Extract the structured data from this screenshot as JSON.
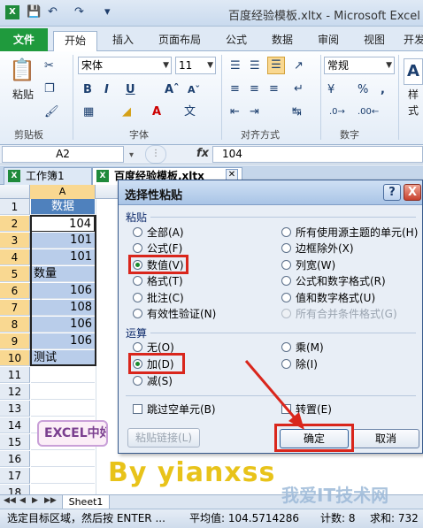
{
  "window": {
    "title": "百度经验模板.xltx - Microsoft Excel"
  },
  "quick_access": {
    "save_icon": "save-icon",
    "undo_icon": "undo-icon",
    "redo_icon": "redo-icon"
  },
  "ribbon_tabs": [
    {
      "label": "文件"
    },
    {
      "label": "开始"
    },
    {
      "label": "插入"
    },
    {
      "label": "页面布局"
    },
    {
      "label": "公式"
    },
    {
      "label": "数据"
    },
    {
      "label": "审阅"
    },
    {
      "label": "视图"
    },
    {
      "label": "开发"
    }
  ],
  "ribbon": {
    "clipboard": {
      "paste_label": "粘贴",
      "group_label": "剪贴板"
    },
    "font": {
      "font_name": "宋体",
      "font_size": "11",
      "bold": "B",
      "italic": "I",
      "underline": "U",
      "group_label": "字体"
    },
    "alignment": {
      "group_label": "对齐方式"
    },
    "number": {
      "format": "常规",
      "percent": "%",
      "comma": ",",
      "group_label": "数字"
    },
    "styles": {
      "label": "样式"
    }
  },
  "formula_bar": {
    "name_box": "A2",
    "fx": "fx",
    "value": "104"
  },
  "workbooks": [
    {
      "label": "工作簿1"
    },
    {
      "label": "百度经验模板.xltx"
    }
  ],
  "sheet": {
    "column_header": "A",
    "rows": [
      "1",
      "2",
      "3",
      "4",
      "5",
      "6",
      "7",
      "8",
      "9",
      "10",
      "11",
      "12",
      "13",
      "14",
      "15",
      "16",
      "17",
      "18"
    ],
    "cells": [
      "数据",
      "104",
      "101",
      "101",
      "数量",
      "106",
      "108",
      "106",
      "106",
      "测试"
    ]
  },
  "overlay_texts": {
    "excel_banner": "EXCEL中好",
    "byline": "By  yianxss",
    "site_watermark": "我爱IT技术网"
  },
  "sheet_tab": {
    "label": "Sheet1"
  },
  "status_bar": {
    "message": "选定目标区域，然后按 ENTER ...",
    "average": "平均值: 104.5714286",
    "count": "计数: 8",
    "sum": "求和: 732"
  },
  "dialog": {
    "title": "选择性粘贴",
    "help": "?",
    "close": "X",
    "paste_section": "粘贴",
    "paste_options_left": [
      "全部(A)",
      "公式(F)",
      "数值(V)",
      "格式(T)",
      "批注(C)",
      "有效性验证(N)"
    ],
    "paste_options_right": [
      "所有使用源主题的单元(H)",
      "边框除外(X)",
      "列宽(W)",
      "公式和数字格式(R)",
      "值和数字格式(U)",
      "所有合并条件格式(G)"
    ],
    "paste_selected": "数值(V)",
    "operation_section": "运算",
    "operation_left": [
      "无(O)",
      "加(D)",
      "减(S)"
    ],
    "operation_right": [
      "乘(M)",
      "除(I)"
    ],
    "operation_selected": "加(D)",
    "skip_blanks": "跳过空单元(B)",
    "transpose": "转置(E)",
    "paste_link": "粘贴链接(L)",
    "ok": "确定",
    "cancel": "取消"
  },
  "colors": {
    "highlight": "#d9261c",
    "excel_green": "#1f9a3d",
    "selection": "#b9cdea"
  }
}
